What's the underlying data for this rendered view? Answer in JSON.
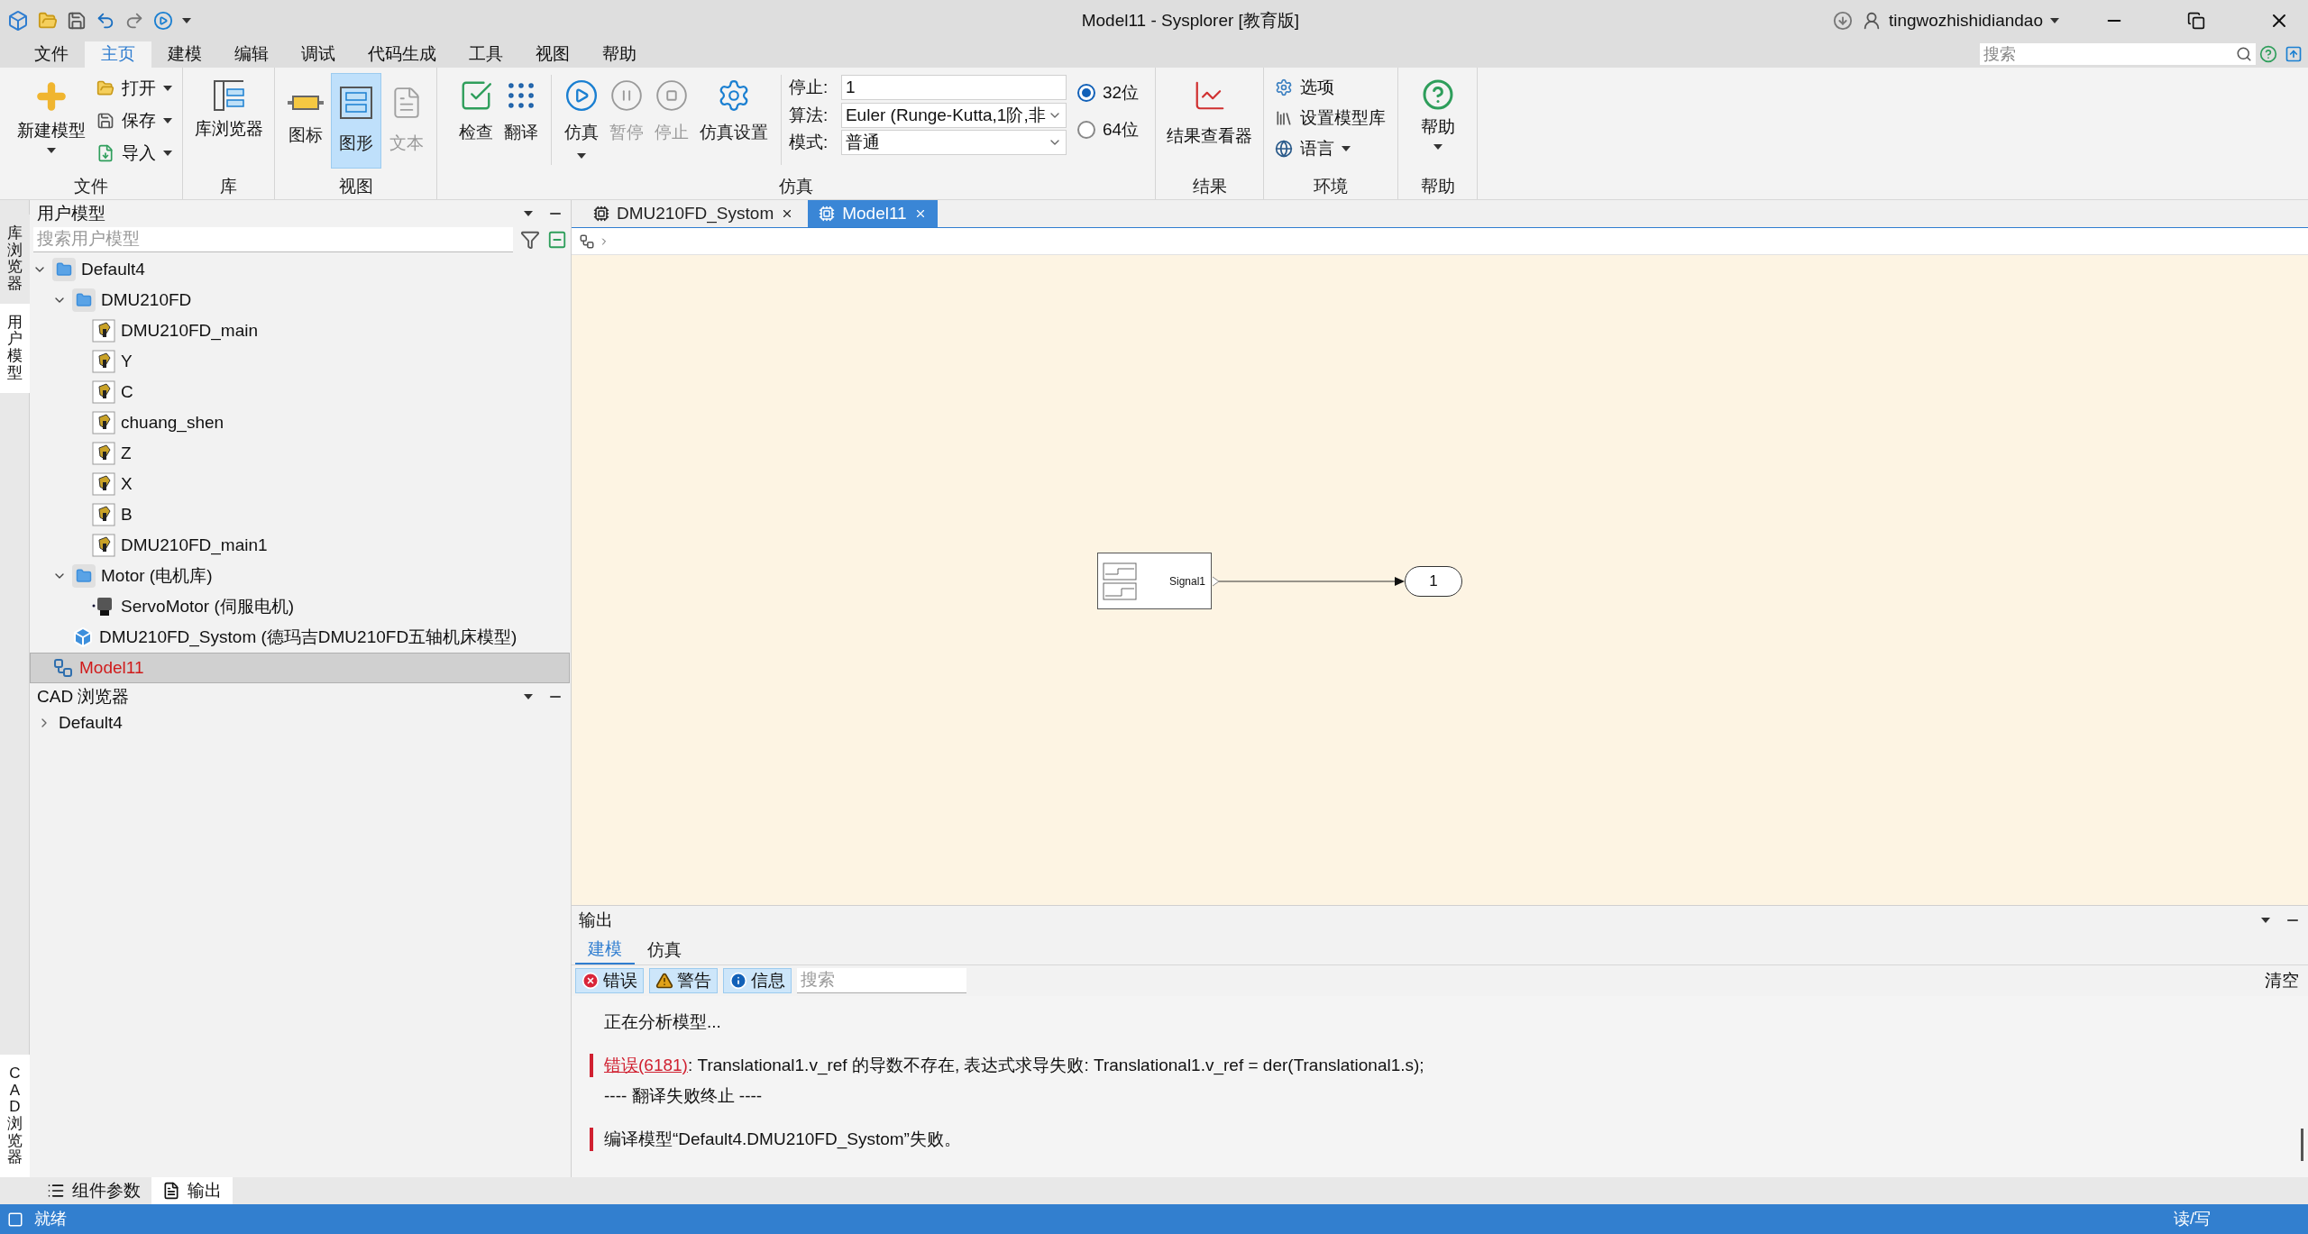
{
  "window": {
    "title": "Model11 - Sysplorer [教育版]",
    "user": "tingwozhishidiandao"
  },
  "search": {
    "placeholder": "搜索"
  },
  "menu": [
    {
      "label": "文件",
      "selected": false
    },
    {
      "label": "主页",
      "selected": true
    },
    {
      "label": "建模",
      "selected": false
    },
    {
      "label": "编辑",
      "selected": false
    },
    {
      "label": "调试",
      "selected": false
    },
    {
      "label": "代码生成",
      "selected": false
    },
    {
      "label": "工具",
      "selected": false
    },
    {
      "label": "视图",
      "selected": false
    },
    {
      "label": "帮助",
      "selected": false
    }
  ],
  "ribbon": {
    "file": {
      "label": "文件",
      "new": "新建模型",
      "small": [
        {
          "label": "打开",
          "kind": "open"
        },
        {
          "label": "保存",
          "kind": "save"
        },
        {
          "label": "导入",
          "kind": "import"
        }
      ]
    },
    "library": {
      "label": "库",
      "button": "库浏览器"
    },
    "view": {
      "label": "视图",
      "buttons": [
        {
          "label": "图标",
          "kind": "chip",
          "selected": false,
          "disabled": false
        },
        {
          "label": "图形",
          "kind": "diagram",
          "selected": true,
          "disabled": false
        },
        {
          "label": "文本",
          "kind": "text",
          "selected": false,
          "disabled": true
        }
      ]
    },
    "simulation": {
      "label": "仿真",
      "buttons": [
        {
          "label": "检查",
          "kind": "check",
          "disabled": false,
          "dropdown": false
        },
        {
          "label": "翻译",
          "kind": "translate",
          "disabled": false,
          "dropdown": false
        },
        {
          "label": "仿真",
          "kind": "play",
          "disabled": false,
          "dropdown": true
        },
        {
          "label": "暂停",
          "kind": "pause",
          "disabled": true,
          "dropdown": false
        },
        {
          "label": "停止",
          "kind": "stop",
          "disabled": true,
          "dropdown": false
        },
        {
          "label": "仿真设置",
          "kind": "settings",
          "disabled": false,
          "dropdown": false
        }
      ],
      "fields": [
        {
          "label": "停止:",
          "value": "1",
          "kind": "text"
        },
        {
          "label": "算法:",
          "value": "Euler (Runge-Kutta,1阶,非",
          "kind": "select"
        },
        {
          "label": "模式:",
          "value": "普通",
          "kind": "select"
        }
      ],
      "precision": [
        {
          "label": "32位",
          "selected": true
        },
        {
          "label": "64位",
          "selected": false
        }
      ]
    },
    "results": {
      "label": "结果",
      "button": "结果查看器"
    },
    "environment": {
      "label": "环境",
      "items": [
        {
          "label": "选项",
          "kind": "gear",
          "dropdown": false
        },
        {
          "label": "设置模型库",
          "kind": "library",
          "dropdown": false
        },
        {
          "label": "语言",
          "kind": "globe",
          "dropdown": true
        }
      ]
    },
    "help": {
      "label": "帮助",
      "button": "帮助"
    }
  },
  "side_tabs": [
    {
      "label": "库浏览器",
      "selected": false
    },
    {
      "label": "用户模型",
      "selected": true
    },
    {
      "label": "CAD 浏览器",
      "selected": true
    }
  ],
  "user_models": {
    "title": "用户模型",
    "placeholder": "搜索用户模型",
    "tree": [
      {
        "label": "Default4",
        "kind": "folder",
        "expanded": true,
        "selected": false,
        "children": [
          {
            "label": "DMU210FD",
            "kind": "folder",
            "expanded": true,
            "selected": false,
            "children": [
              {
                "label": "DMU210FD_main",
                "kind": "part",
                "selected": false
              },
              {
                "label": "Y",
                "kind": "part",
                "selected": false
              },
              {
                "label": "C",
                "kind": "part",
                "selected": false
              },
              {
                "label": "chuang_shen",
                "kind": "part",
                "selected": false
              },
              {
                "label": "Z",
                "kind": "part",
                "selected": false
              },
              {
                "label": "X",
                "kind": "part",
                "selected": false
              },
              {
                "label": "B",
                "kind": "part",
                "selected": false
              },
              {
                "label": "DMU210FD_main1",
                "kind": "part",
                "selected": false
              }
            ]
          },
          {
            "label": "Motor (电机库)",
            "kind": "folder",
            "expanded": true,
            "selected": false,
            "children": [
              {
                "label": "ServoMotor (伺服电机)",
                "kind": "motor",
                "selected": false
              }
            ]
          },
          {
            "label": "DMU210FD_Systom (德玛吉DMU210FD五轴机床模型)",
            "kind": "package",
            "selected": false
          }
        ]
      },
      {
        "label": "Model11",
        "kind": "diagram",
        "selected": true
      }
    ]
  },
  "cad_browser": {
    "title": "CAD 浏览器",
    "tree": [
      {
        "label": "Default4",
        "expanded": false
      }
    ]
  },
  "doc_tabs": [
    {
      "label": "DMU210FD_Systom",
      "selected": false
    },
    {
      "label": "Model11",
      "selected": true
    }
  ],
  "diagram": {
    "block": "Signal1",
    "output": "1"
  },
  "output": {
    "title": "输出",
    "tabs": [
      {
        "label": "建模",
        "selected": true
      },
      {
        "label": "仿真",
        "selected": false
      }
    ],
    "filters": [
      {
        "label": "错误",
        "kind": "error"
      },
      {
        "label": "警告",
        "kind": "warning"
      },
      {
        "label": "信息",
        "kind": "info"
      }
    ],
    "placeholder": "搜索",
    "clear": "清空",
    "messages": [
      {
        "text": "正在分析模型...",
        "marked": false
      },
      {
        "link": "错误(6181)",
        "text": ": Translational1.v_ref 的导数不存在, 表达式求导失败: Translational1.v_ref = der(Translational1.s);",
        "marked": true
      },
      {
        "text": "---- 翻译失败终止 ----",
        "marked": false
      },
      {
        "text": "编译模型“Default4.DMU210FD_Systom”失败。",
        "marked": true
      }
    ]
  },
  "bottom_tabs": [
    {
      "label": "组件参数",
      "kind": "list",
      "selected": false
    },
    {
      "label": "输出",
      "kind": "output",
      "selected": true
    }
  ],
  "status_bar": {
    "left": "就绪",
    "right": "读/写"
  }
}
